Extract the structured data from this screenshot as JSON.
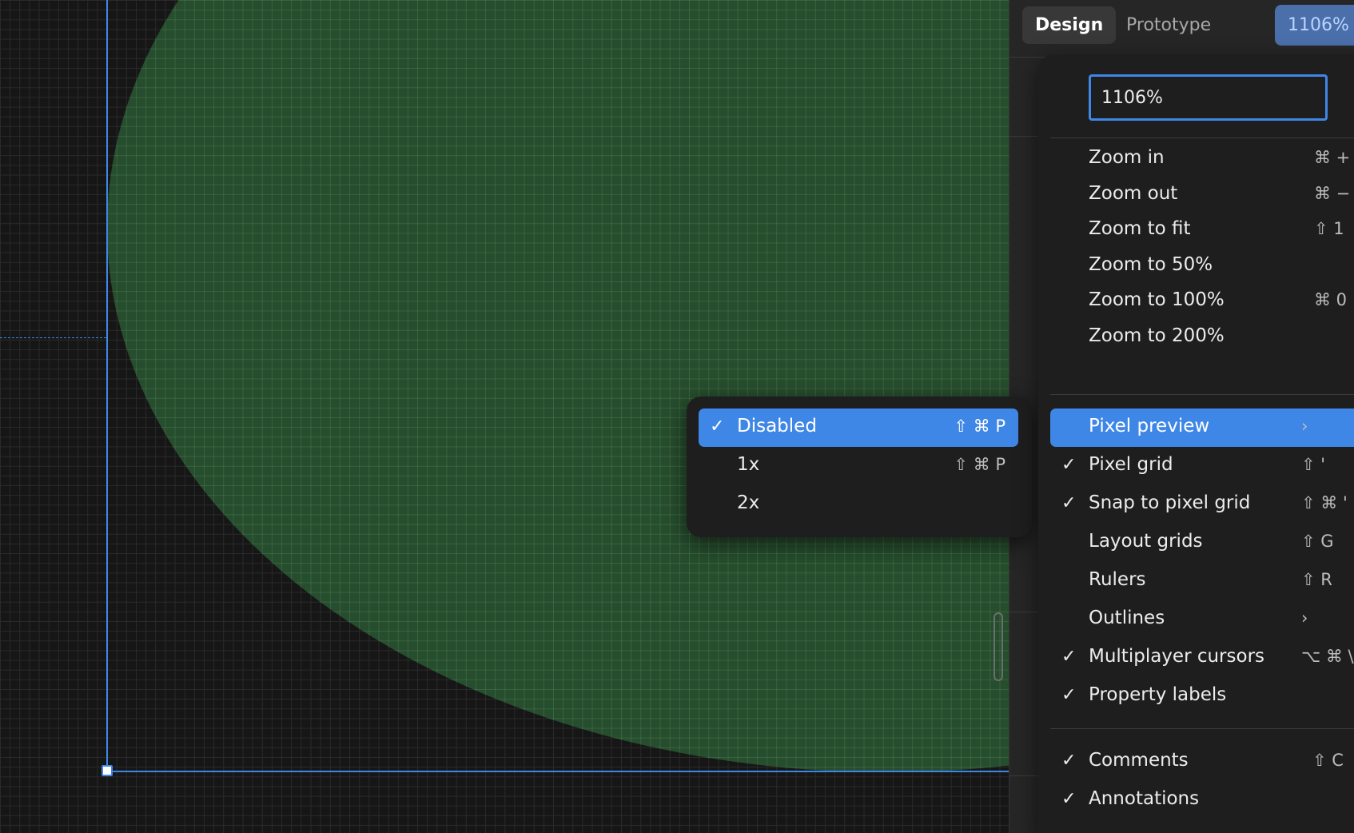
{
  "tabs": {
    "design": "Design",
    "prototype": "Prototype"
  },
  "zoom_level": "1106%",
  "zoom_input_value": "1106%",
  "zoom_menu": {
    "zoom_items": [
      {
        "label": "Zoom in",
        "shortcut": "⌘ +"
      },
      {
        "label": "Zoom out",
        "shortcut": "⌘ −"
      },
      {
        "label": "Zoom to fit",
        "shortcut": "⇧ 1"
      },
      {
        "label": "Zoom to 50%",
        "shortcut": ""
      },
      {
        "label": "Zoom to 100%",
        "shortcut": "⌘ 0"
      },
      {
        "label": "Zoom to 200%",
        "shortcut": ""
      }
    ],
    "view_items": [
      {
        "label": "Pixel preview",
        "checked": false,
        "shortcut": "›"
      },
      {
        "label": "Pixel grid",
        "checked": true,
        "shortcut": "⇧ '"
      },
      {
        "label": "Snap to pixel grid",
        "checked": true,
        "shortcut": "⇧ ⌘ '"
      },
      {
        "label": "Layout grids",
        "checked": false,
        "shortcut": "⇧ G"
      },
      {
        "label": "Rulers",
        "checked": false,
        "shortcut": "⇧ R"
      },
      {
        "label": "Outlines",
        "checked": false,
        "shortcut": "›"
      },
      {
        "label": "Multiplayer cursors",
        "checked": true,
        "shortcut": "⌥ ⌘ \\"
      },
      {
        "label": "Property labels",
        "checked": true,
        "shortcut": ""
      }
    ],
    "other_items": [
      {
        "label": "Comments",
        "checked": true,
        "shortcut": "⇧ C"
      },
      {
        "label": "Annotations",
        "checked": true,
        "shortcut": ""
      }
    ]
  },
  "pixel_preview_submenu": [
    {
      "label": "Disabled",
      "checked": true,
      "shortcut": "⇧ ⌘ P"
    },
    {
      "label": "1x",
      "checked": false,
      "shortcut": "⇧ ⌘ P"
    },
    {
      "label": "2x",
      "checked": false,
      "shortcut": ""
    }
  ],
  "colors": {
    "accent": "#3f87e6",
    "shape_fill": "#264d2d",
    "canvas_bg": "#161616",
    "menu_bg": "#1e1e1e",
    "panel_bg": "#262626"
  },
  "icons": {
    "check": "checkmark-icon",
    "submenu": "chevron-right-icon"
  }
}
